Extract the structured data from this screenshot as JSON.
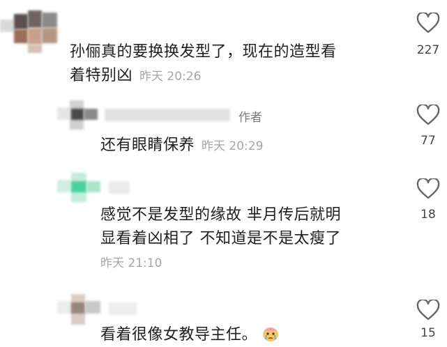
{
  "comments": [
    {
      "text_line1": "孙俪真的要换换发型了，现在的造型看",
      "text_line2": "着特别凶",
      "time": "昨天 20:26",
      "likes": "227"
    },
    {
      "author_tag": "作者",
      "text": "还有眼睛保养",
      "time": "昨天 20:29",
      "likes": "77"
    },
    {
      "text_line1": "感觉不是发型的缘故  芈月传后就明",
      "text_line2": "显看着凶相了 不知道是不是太瘦了",
      "time": "昨天 21:10",
      "likes": "18"
    },
    {
      "text": "看着很像女教导主任。",
      "emoji": "crying-face-emoji",
      "likes": "15"
    }
  ],
  "icons": {
    "like": "heart-outline-icon"
  },
  "colors": {
    "text": "#1f1f1f",
    "time": "#a6a6a6",
    "count": "#444444"
  }
}
